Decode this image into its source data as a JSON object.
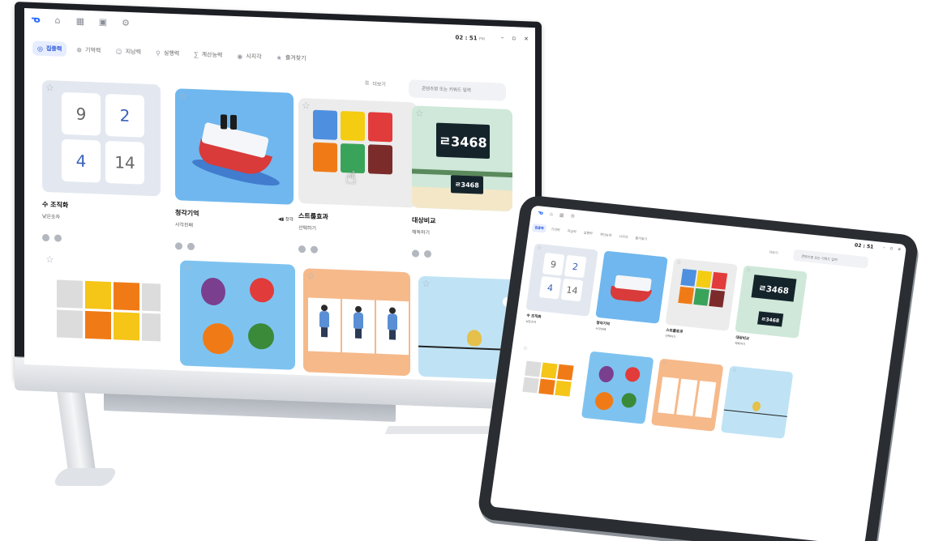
{
  "window": {
    "clock": "02 : 51",
    "ampm": "PM",
    "minimize": "–",
    "maximize": "▫",
    "close": "×"
  },
  "tabs": [
    {
      "label": "집중력",
      "icon": "◎"
    },
    {
      "label": "기억력",
      "icon": "❁"
    },
    {
      "label": "지남력",
      "icon": "☺"
    },
    {
      "label": "실행력",
      "icon": "⚲"
    },
    {
      "label": "계산능력",
      "icon": "∑"
    },
    {
      "label": "시지각",
      "icon": "◉"
    },
    {
      "label": "즐겨찾기",
      "icon": "★"
    }
  ],
  "more_label": "더보기",
  "search": {
    "placeholder": "콘텐츠명 또는 키워드 입력"
  },
  "cards": [
    {
      "title": "수 조직화",
      "subtitle": "낮은숫자",
      "numbers": [
        "9",
        "2",
        "4",
        "14"
      ]
    },
    {
      "title": "청각기억",
      "subtitle": "사각진배",
      "badge": "청각"
    },
    {
      "title": "스트룹효과",
      "subtitle": "선택하기"
    },
    {
      "title": "대상비교",
      "subtitle": "해독하기",
      "plate_large": "ㄹ3468",
      "plate_small": "ㄹ3468"
    }
  ],
  "tablet": {
    "clock": "02 : 51",
    "tabs": [
      "집중력",
      "기억력",
      "지남력",
      "실행력",
      "계산능력",
      "시지각",
      "즐겨찾기"
    ],
    "more_label": "더보기",
    "search_placeholder": "콘텐츠명 또는 키워드 입력",
    "numbers": [
      "9",
      "2",
      "4",
      "14"
    ],
    "plate": "ㄹ3468",
    "plate_small": "ㄹ3468",
    "cards": [
      {
        "title": "수 조직화",
        "subtitle": "낮은숫자"
      },
      {
        "title": "청각기억",
        "subtitle": "사각진배"
      },
      {
        "title": "스트룹효과",
        "subtitle": "선택하기"
      },
      {
        "title": "대상비교",
        "subtitle": "해독하기"
      }
    ]
  },
  "colors": {
    "accent": "#2251d6",
    "card_bg_numbers": "#e3e8f0",
    "card_bg_ship": "#6fb7ee",
    "card_bg_stroop": "#ececec",
    "card_bg_compare": "#cfe8d9",
    "stroop": [
      "#4e8fe0",
      "#f4cc12",
      "#e23b3b",
      "#f07b16",
      "#3aa35a",
      "#7c2b2b"
    ]
  }
}
